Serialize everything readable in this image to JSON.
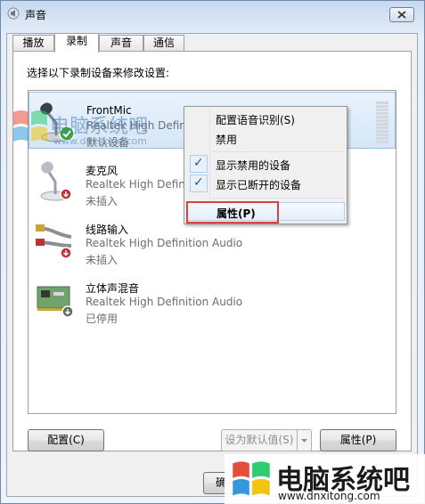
{
  "window": {
    "title": "声音"
  },
  "tabs": [
    {
      "label": "播放"
    },
    {
      "label": "录制"
    },
    {
      "label": "声音"
    },
    {
      "label": "通信"
    }
  ],
  "instruction": "选择以下录制设备来修改设置:",
  "devices": [
    {
      "name": "FrontMic",
      "driver": "Realtek High Definition Audio",
      "status": "默认设备",
      "icon": "microphone-icon",
      "badge": "default-check-icon"
    },
    {
      "name": "麦克风",
      "driver": "Realtek High Definition Audio",
      "status": "未插入",
      "icon": "microphone-icon",
      "badge": "unplugged-icon"
    },
    {
      "name": "线路输入",
      "driver": "Realtek High Definition Audio",
      "status": "未插入",
      "icon": "rca-cable-icon",
      "badge": "unplugged-icon"
    },
    {
      "name": "立体声混音",
      "driver": "Realtek High Definition Audio",
      "status": "已停用",
      "icon": "sound-card-icon",
      "badge": "disabled-icon"
    }
  ],
  "context_menu": {
    "items": [
      {
        "label": "配置语音识别(S)",
        "checked": false
      },
      {
        "label": "禁用",
        "checked": false
      },
      {
        "label": "显示禁用的设备",
        "checked": true
      },
      {
        "label": "显示已断开的设备",
        "checked": true
      },
      {
        "label": "属性(P)",
        "checked": false,
        "bold": true,
        "highlighted": true
      }
    ]
  },
  "buttons": {
    "configure": "配置(C)",
    "set_default": "设为默认值(S)",
    "properties": "属性(P)",
    "ok_partial": "确"
  },
  "watermark": {
    "brand": "电脑系统吧",
    "url": "www.dnxitong.com"
  },
  "colors": {
    "highlight_box": "#d94040",
    "check": "#1d55a5",
    "selection": "#d4e6f8"
  }
}
